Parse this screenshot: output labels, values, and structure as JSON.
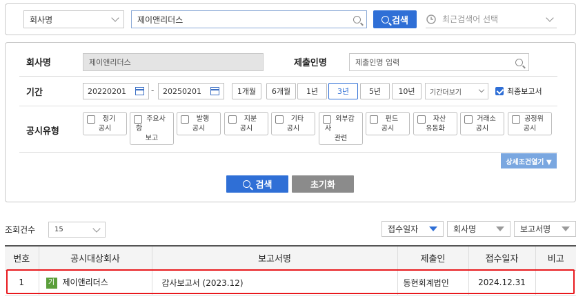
{
  "top": {
    "scope_select": "회사명",
    "search_value": "제이앤리더스",
    "search_button": "검색",
    "recent_label": "최근검색어 선택"
  },
  "criteria": {
    "company_label": "회사명",
    "company_value": "제이앤리더스",
    "submitter_label": "제출인명",
    "submitter_placeholder": "제출인명 입력",
    "period_label": "기간",
    "date_from": "20220201",
    "date_sep": "-",
    "date_to": "20250201",
    "period_buttons": [
      "1개월",
      "6개월",
      "1년",
      "3년",
      "5년",
      "10년"
    ],
    "period_active": "3년",
    "period_more": "기간더보기",
    "final_report_label": "최종보고서",
    "type_label": "공시유형",
    "types": [
      {
        "l1": "정기",
        "l2": "공시",
        "l3": ""
      },
      {
        "l1": "주요사",
        "l2": "항",
        "l3": "보고"
      },
      {
        "l1": "발행",
        "l2": "공시",
        "l3": ""
      },
      {
        "l1": "지분",
        "l2": "공시",
        "l3": ""
      },
      {
        "l1": "기타",
        "l2": "공시",
        "l3": ""
      },
      {
        "l1": "외부감",
        "l2": "사",
        "l3": "관련"
      },
      {
        "l1": "펀드",
        "l2": "공시",
        "l3": ""
      },
      {
        "l1": "자산",
        "l2": "유동화",
        "l3": ""
      },
      {
        "l1": "거래소",
        "l2": "공시",
        "l3": ""
      },
      {
        "l1": "공정위",
        "l2": "공시",
        "l3": ""
      }
    ],
    "advanced_button": "상세조건열기 ▼",
    "search_button": "검색",
    "reset_button": "초기화"
  },
  "results": {
    "count_label": "조회건수",
    "count_value": "15",
    "sort_options": [
      "접수일자",
      "회사명",
      "보고서명"
    ],
    "columns": [
      "번호",
      "공시대상회사",
      "보고서명",
      "제출인",
      "접수일자",
      "비고"
    ],
    "rows": [
      {
        "no": "1",
        "badge": "기",
        "company": "제이앤리더스",
        "report": "감사보고서 (2023.12)",
        "submitter": "동현회계법인",
        "date": "2024.12.31",
        "note": ""
      }
    ]
  },
  "colors": {
    "accent": "#2f6fd6",
    "highlight": "#e8181d",
    "badge": "#5a9e3a"
  }
}
